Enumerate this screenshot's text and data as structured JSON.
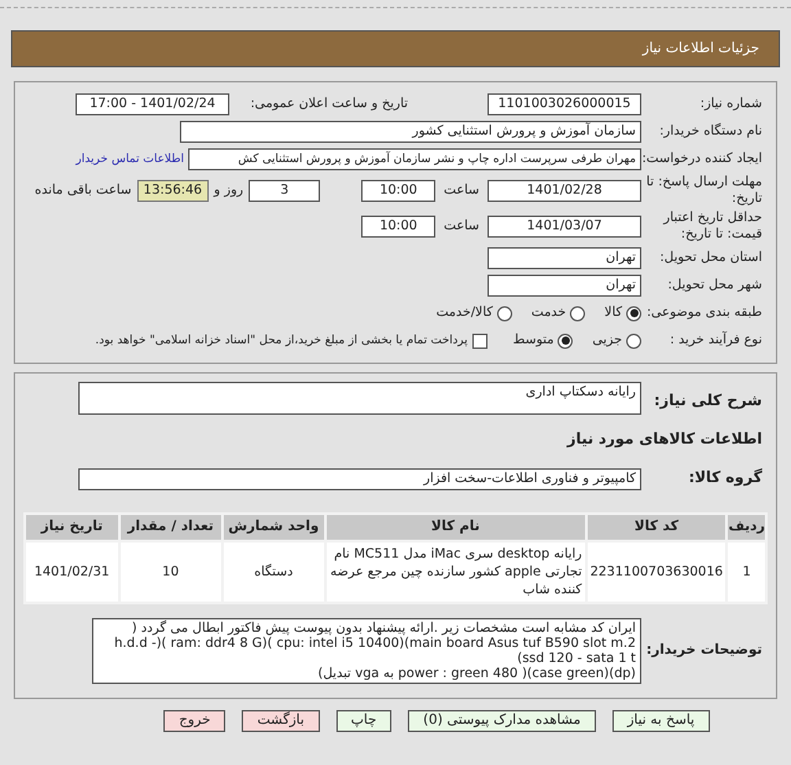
{
  "header": {
    "title": "جزئیات اطلاعات نیاز"
  },
  "need_number": {
    "label": "شماره نیاز:",
    "value": "1101003026000015"
  },
  "announce": {
    "label": "تاریخ و ساعت اعلان عمومی:",
    "value": "1401/02/24 - 17:00"
  },
  "buyer_org": {
    "label": "نام دستگاه خریدار:",
    "value": "سازمان آموزش و پرورش استثنایی کشور"
  },
  "requester": {
    "label": "ایجاد کننده درخواست:",
    "value": "مهران طرفی سرپرست اداره چاپ و نشر سازمان آموزش و پرورش استثنایی کش",
    "link": "اطلاعات تماس خریدار"
  },
  "deadline": {
    "label": "مهلت ارسال پاسخ: تا تاریخ:",
    "date": "1401/02/28",
    "time_label": "ساعت",
    "time": "10:00",
    "days": "3",
    "days_label": "روز و",
    "remaining": "13:56:46",
    "remaining_label": "ساعت باقی مانده"
  },
  "validity": {
    "label": "حداقل تاریخ اعتبار قیمت: تا تاریخ:",
    "date": "1401/03/07",
    "time_label": "ساعت",
    "time": "10:00"
  },
  "province": {
    "label": "استان محل تحویل:",
    "value": "تهران"
  },
  "city": {
    "label": "شهر محل تحویل:",
    "value": "تهران"
  },
  "category": {
    "label": "طبقه بندی موضوعی:",
    "options": [
      {
        "label": "کالا",
        "selected": true
      },
      {
        "label": "خدمت",
        "selected": false
      },
      {
        "label": "کالا/خدمت",
        "selected": false
      }
    ]
  },
  "process": {
    "label": "نوع فرآیند خرید :",
    "options": [
      {
        "label": "جزیی",
        "selected": false
      },
      {
        "label": "متوسط",
        "selected": true
      }
    ],
    "payment": {
      "label": "پرداخت تمام یا بخشی از مبلغ خرید،از محل \"اسناد خزانه اسلامی\" خواهد بود.",
      "checked": false
    }
  },
  "summary": {
    "label": "شرح کلی نیاز:",
    "value": "رایانه دسکتاپ اداری"
  },
  "items_title": "اطلاعات کالاهای مورد نیاز",
  "group": {
    "label": "گروه کالا:",
    "value": "کامپیوتر و فناوری اطلاعات-سخت افزار"
  },
  "table": {
    "columns": [
      "ردیف",
      "کد کالا",
      "نام کالا",
      "واحد شمارش",
      "تعداد / مقدار",
      "تاریخ نیاز"
    ],
    "rows": [
      [
        "1",
        "2231100703630016",
        "رایانه desktop سری iMac مدل MC511 نام تجارتی apple کشور سازنده چین مرجع عرضه کننده شاب",
        "دستگاه",
        "10",
        "1401/02/31"
      ]
    ]
  },
  "notes": {
    "label": "توضیحات خریدار:",
    "value": "ایران کد مشابه است مشخصات زیر .ارائه پیشنهاد بدون پیوست پیش فاکتور ابطال می گردد ( main board Asus tuf B590 slot m.2)(cpu: intel i5 10400 )(ram: ddr4  8 G )(h.d.d -ssd 120    -  sata 1 t)\n(dp)(case green)( power : green 480 به vga تبدیل)"
  },
  "buttons": [
    {
      "label": "پاسخ به نیاز",
      "kind": "action"
    },
    {
      "label": "مشاهده مدارک پیوستی (0)",
      "kind": "action"
    },
    {
      "label": "چاپ",
      "kind": "action"
    },
    {
      "label": "بازگشت",
      "kind": "exit"
    },
    {
      "label": "خروج",
      "kind": "exit"
    }
  ]
}
